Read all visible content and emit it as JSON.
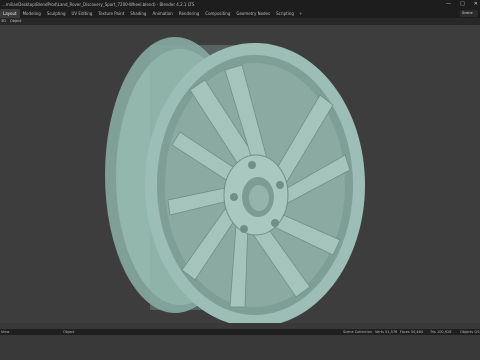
{
  "window": {
    "title": "...mil\\anDesktop\\BlendProd\\Land_Rover_Discovery_Sport_7200-Wheel.blend) - Blender 4.2.1 LTS",
    "controls": {
      "minimize": "—",
      "maximize": "□",
      "close": "✕"
    }
  },
  "workspace_tabs": [
    {
      "label": "Layout"
    },
    {
      "label": "Modeling"
    },
    {
      "label": "Sculpting"
    },
    {
      "label": "UV Editing"
    },
    {
      "label": "Texture Paint"
    },
    {
      "label": "Shading"
    },
    {
      "label": "Animation"
    },
    {
      "label": "Rendering"
    },
    {
      "label": "Compositing"
    },
    {
      "label": "Geometry Nodes"
    },
    {
      "label": "Scripting"
    }
  ],
  "add_tab_label": "+",
  "scene_field": "Scene",
  "header_menu": {
    "left1": "3D",
    "left2": "Object"
  },
  "toolbar": {
    "transform_orientation": "Global"
  },
  "status_bar": {
    "left": "View",
    "left2": "Object",
    "scene_collection": "Scene Collection",
    "verts": "Verts 51,576",
    "faces": "Faces 50,464",
    "tris": "Tris 100,928",
    "objects": "Objects 0/1"
  },
  "colors": {
    "wheel_base": "#8fb3aa",
    "viewport_bg": "#3d3d3d",
    "topbar_bg": "#1d1d1d"
  }
}
